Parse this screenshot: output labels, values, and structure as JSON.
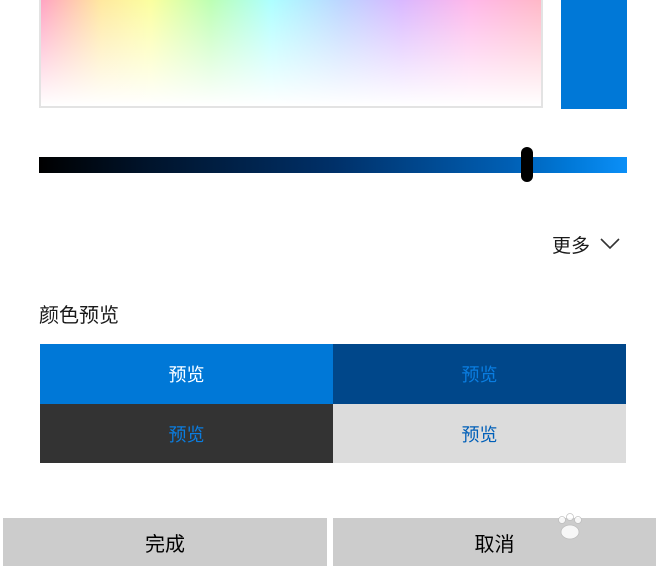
{
  "colors": {
    "current": "#0078d7",
    "preview_bg_1": "#0078d7",
    "preview_bg_2": "#00478a",
    "preview_bg_3": "#333333",
    "preview_bg_4": "#dcdcdc",
    "button_bg": "#cccccc"
  },
  "picker": {
    "brightness_percent": 83
  },
  "more": {
    "label": "更多",
    "icon": "chevron-down-icon"
  },
  "preview": {
    "title": "颜色预览",
    "cells": [
      {
        "label": "预览"
      },
      {
        "label": "预览"
      },
      {
        "label": "预览"
      },
      {
        "label": "预览"
      }
    ]
  },
  "buttons": {
    "done_label": "完成",
    "cancel_label": "取消"
  }
}
